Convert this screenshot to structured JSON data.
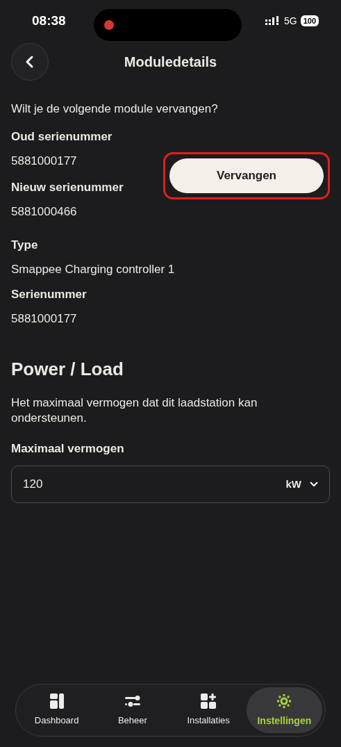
{
  "status_bar": {
    "time": "08:38",
    "recording": true,
    "network": "5G",
    "battery": "100"
  },
  "header": {
    "title": "Moduledetails"
  },
  "replace": {
    "question": "Wilt je de volgende module vervangen?",
    "fields": [
      {
        "label": "Oud serienummer",
        "value": "5881000177"
      },
      {
        "label": "Nieuw serienummer",
        "value": "5881000466"
      }
    ],
    "button": {
      "label": "Vervangen",
      "highlighted": true
    }
  },
  "details": [
    {
      "label": "Type",
      "value": "Smappee Charging controller 1"
    },
    {
      "label": "Serienummer",
      "value": "5881000177"
    }
  ],
  "power": {
    "heading": "Power / Load",
    "description": "Het maximaal vermogen dat dit laadstation kan ondersteunen.",
    "field_label": "Maximaal vermogen",
    "value": "120",
    "unit": "kW"
  },
  "nav": [
    {
      "kind": "dashboard",
      "label": "Dashboard",
      "selected": false
    },
    {
      "kind": "sliders",
      "label": "Beheer",
      "selected": false
    },
    {
      "kind": "add",
      "label": "Installaties",
      "selected": false
    },
    {
      "kind": "gear",
      "label": "Instellingen",
      "selected": true
    }
  ]
}
